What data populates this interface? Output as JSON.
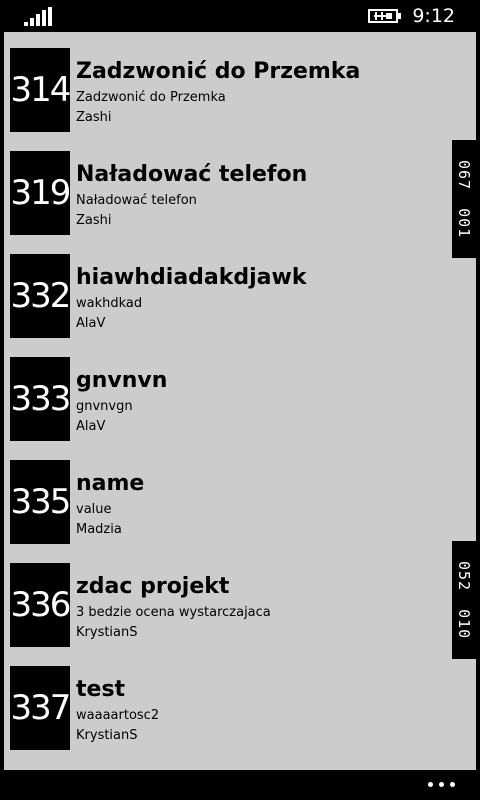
{
  "status_bar": {
    "time": "9:12",
    "signal_icon": "signal-strength-icon",
    "battery_icon": "battery-charging-icon"
  },
  "tasks": [
    {
      "id": "314",
      "title": "Zadzwonić do Przemka",
      "value": "Zadzwonić do Przemka",
      "author": "Zashi"
    },
    {
      "id": "319",
      "title": "Naładować telefon",
      "value": "Naładować telefon",
      "author": "Zashi"
    },
    {
      "id": "332",
      "title": "hiawhdiadakdjawk",
      "value": "wakhdkad",
      "author": "AlaV"
    },
    {
      "id": "333",
      "title": "gnvnvn",
      "value": "gnvnvgn",
      "author": "AlaV"
    },
    {
      "id": "335",
      "title": "name",
      "value": "value",
      "author": "Madzia"
    },
    {
      "id": "336",
      "title": "zdac projekt",
      "value": "3 bedzie ocena wystarczajaca",
      "author": "KrystianS"
    },
    {
      "id": "337",
      "title": "test",
      "value": "waaaartosc2",
      "author": "KrystianS"
    }
  ],
  "side_tabs": [
    {
      "text": "067 001"
    },
    {
      "text": "052 010"
    }
  ],
  "app_bar": {
    "more_icon": "ellipsis-icon"
  },
  "colors": {
    "background": "#000000",
    "panel": "#cccccc",
    "text": "#000000",
    "id_box": "#000000",
    "id_text": "#ffffff"
  }
}
